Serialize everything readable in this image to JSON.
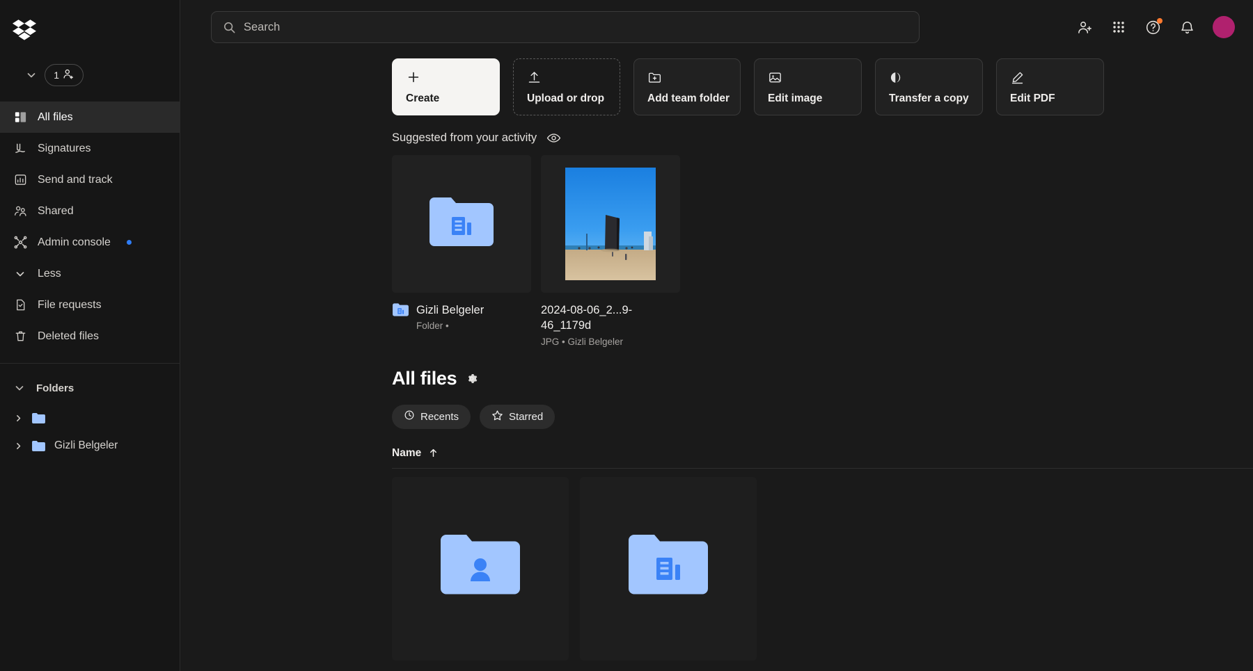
{
  "app": {
    "name": "Dropbox",
    "logo_icon": "dropbox-logo-icon"
  },
  "sidebar": {
    "team_selector": {
      "count": "1",
      "icon": "add-person-icon",
      "chevron_icon": "chevron-down-icon"
    },
    "items": [
      {
        "label": "All files",
        "icon": "all-files-icon",
        "active": true
      },
      {
        "label": "Signatures",
        "icon": "signature-icon",
        "active": false
      },
      {
        "label": "Send and track",
        "icon": "send-track-icon",
        "active": false
      },
      {
        "label": "Shared",
        "icon": "shared-people-icon",
        "active": false
      },
      {
        "label": "Admin console",
        "icon": "admin-console-icon",
        "active": false,
        "has_dot": true
      },
      {
        "label": "Less",
        "icon": "chevron-down-icon",
        "active": false
      },
      {
        "label": "File requests",
        "icon": "file-request-icon",
        "active": false
      },
      {
        "label": "Deleted files",
        "icon": "trash-icon",
        "active": false
      }
    ],
    "folders_section": {
      "label": "Folders",
      "chevron_icon": "chevron-down-icon",
      "tree": [
        {
          "label": "",
          "icon": "folder-icon",
          "caret": "chevron-right-icon"
        },
        {
          "label": "Gizli Belgeler",
          "icon": "folder-icon",
          "caret": "chevron-right-icon"
        }
      ]
    }
  },
  "header": {
    "search": {
      "placeholder": "Search",
      "value": "",
      "icon": "search-icon"
    },
    "icons": [
      {
        "name": "invite-member-icon",
        "badge": false
      },
      {
        "name": "apps-grid-icon",
        "badge": false
      },
      {
        "name": "help-circle-icon",
        "badge": true
      },
      {
        "name": "notifications-bell-icon",
        "badge": false
      }
    ],
    "avatar": {
      "name": "user-avatar",
      "color": "#b0216e"
    }
  },
  "actions": [
    {
      "label": "Create",
      "icon": "plus-icon",
      "style": "primary"
    },
    {
      "label": "Upload or drop",
      "icon": "upload-icon",
      "style": "dashed"
    },
    {
      "label": "Add team folder",
      "icon": "folder-plus-icon",
      "style": "normal"
    },
    {
      "label": "Edit image",
      "icon": "image-icon",
      "style": "normal"
    },
    {
      "label": "Transfer a copy",
      "icon": "transfer-icon",
      "style": "normal"
    },
    {
      "label": "Edit PDF",
      "icon": "pencil-edit-icon",
      "style": "normal"
    }
  ],
  "suggested": {
    "title": "Suggested from your activity",
    "eye_icon": "eye-icon",
    "cards": [
      {
        "name": "Gizli Belgeler",
        "sub": "Folder •",
        "thumb": "team-folder-icon",
        "badge_icon": "team-folder-icon"
      },
      {
        "name": "2024-08-06_2...9-46_1179d",
        "sub": "JPG • Gizli Belgeler",
        "thumb": "beach-photo"
      }
    ]
  },
  "all_files": {
    "title": "All files",
    "gear_icon": "settings-gear-icon",
    "pills": [
      {
        "label": "Recents",
        "icon": "clock-icon"
      },
      {
        "label": "Starred",
        "icon": "star-icon"
      }
    ],
    "column_header": {
      "label": "Name",
      "sort_icon": "arrow-up-icon"
    },
    "grid": [
      {
        "name": "",
        "icon": "personal-folder-icon"
      },
      {
        "name": "",
        "icon": "team-folder-icon"
      }
    ]
  },
  "colors": {
    "background": "#1a1a1a",
    "sidebar": "#161616",
    "folder_blue": "#a2c6ff",
    "accent_blue": "#3b82f6",
    "badge_orange": "#ff7a2f",
    "avatar_magenta": "#b0216e"
  }
}
